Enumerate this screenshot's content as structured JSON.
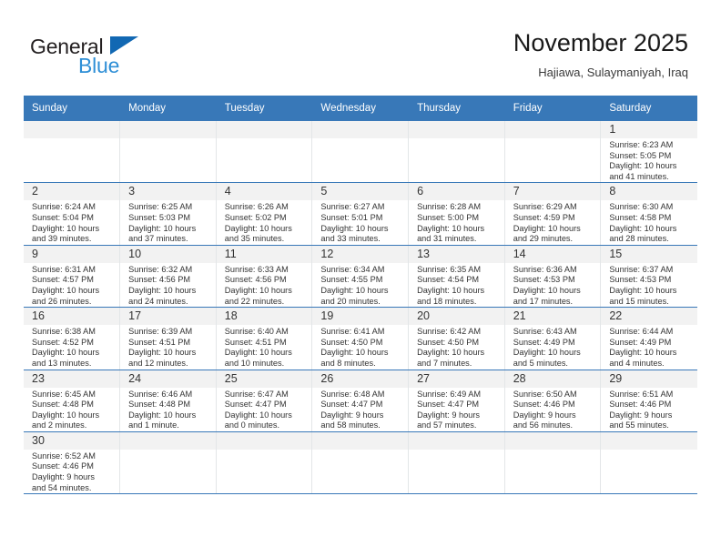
{
  "logo": {
    "text_primary": "General",
    "text_secondary": "Blue",
    "icon": "triangle-mark",
    "color_primary": "#231f20",
    "color_secondary": "#2f8fd6",
    "color_triangle": "#1268b3"
  },
  "header": {
    "title": "November 2025",
    "subtitle": "Hajiawa, Sulaymaniyah, Iraq"
  },
  "theme": {
    "header_blue": "#3878b8",
    "daynum_band": "#f2f2f2",
    "text": "#333333"
  },
  "weekdays": [
    "Sunday",
    "Monday",
    "Tuesday",
    "Wednesday",
    "Thursday",
    "Friday",
    "Saturday"
  ],
  "weeks": [
    [
      {
        "empty": true
      },
      {
        "empty": true
      },
      {
        "empty": true
      },
      {
        "empty": true
      },
      {
        "empty": true
      },
      {
        "empty": true
      },
      {
        "day": "1",
        "sunrise": "Sunrise: 6:23 AM",
        "sunset": "Sunset: 5:05 PM",
        "daylight1": "Daylight: 10 hours",
        "daylight2": "and 41 minutes."
      }
    ],
    [
      {
        "day": "2",
        "sunrise": "Sunrise: 6:24 AM",
        "sunset": "Sunset: 5:04 PM",
        "daylight1": "Daylight: 10 hours",
        "daylight2": "and 39 minutes."
      },
      {
        "day": "3",
        "sunrise": "Sunrise: 6:25 AM",
        "sunset": "Sunset: 5:03 PM",
        "daylight1": "Daylight: 10 hours",
        "daylight2": "and 37 minutes."
      },
      {
        "day": "4",
        "sunrise": "Sunrise: 6:26 AM",
        "sunset": "Sunset: 5:02 PM",
        "daylight1": "Daylight: 10 hours",
        "daylight2": "and 35 minutes."
      },
      {
        "day": "5",
        "sunrise": "Sunrise: 6:27 AM",
        "sunset": "Sunset: 5:01 PM",
        "daylight1": "Daylight: 10 hours",
        "daylight2": "and 33 minutes."
      },
      {
        "day": "6",
        "sunrise": "Sunrise: 6:28 AM",
        "sunset": "Sunset: 5:00 PM",
        "daylight1": "Daylight: 10 hours",
        "daylight2": "and 31 minutes."
      },
      {
        "day": "7",
        "sunrise": "Sunrise: 6:29 AM",
        "sunset": "Sunset: 4:59 PM",
        "daylight1": "Daylight: 10 hours",
        "daylight2": "and 29 minutes."
      },
      {
        "day": "8",
        "sunrise": "Sunrise: 6:30 AM",
        "sunset": "Sunset: 4:58 PM",
        "daylight1": "Daylight: 10 hours",
        "daylight2": "and 28 minutes."
      }
    ],
    [
      {
        "day": "9",
        "sunrise": "Sunrise: 6:31 AM",
        "sunset": "Sunset: 4:57 PM",
        "daylight1": "Daylight: 10 hours",
        "daylight2": "and 26 minutes."
      },
      {
        "day": "10",
        "sunrise": "Sunrise: 6:32 AM",
        "sunset": "Sunset: 4:56 PM",
        "daylight1": "Daylight: 10 hours",
        "daylight2": "and 24 minutes."
      },
      {
        "day": "11",
        "sunrise": "Sunrise: 6:33 AM",
        "sunset": "Sunset: 4:56 PM",
        "daylight1": "Daylight: 10 hours",
        "daylight2": "and 22 minutes."
      },
      {
        "day": "12",
        "sunrise": "Sunrise: 6:34 AM",
        "sunset": "Sunset: 4:55 PM",
        "daylight1": "Daylight: 10 hours",
        "daylight2": "and 20 minutes."
      },
      {
        "day": "13",
        "sunrise": "Sunrise: 6:35 AM",
        "sunset": "Sunset: 4:54 PM",
        "daylight1": "Daylight: 10 hours",
        "daylight2": "and 18 minutes."
      },
      {
        "day": "14",
        "sunrise": "Sunrise: 6:36 AM",
        "sunset": "Sunset: 4:53 PM",
        "daylight1": "Daylight: 10 hours",
        "daylight2": "and 17 minutes."
      },
      {
        "day": "15",
        "sunrise": "Sunrise: 6:37 AM",
        "sunset": "Sunset: 4:53 PM",
        "daylight1": "Daylight: 10 hours",
        "daylight2": "and 15 minutes."
      }
    ],
    [
      {
        "day": "16",
        "sunrise": "Sunrise: 6:38 AM",
        "sunset": "Sunset: 4:52 PM",
        "daylight1": "Daylight: 10 hours",
        "daylight2": "and 13 minutes."
      },
      {
        "day": "17",
        "sunrise": "Sunrise: 6:39 AM",
        "sunset": "Sunset: 4:51 PM",
        "daylight1": "Daylight: 10 hours",
        "daylight2": "and 12 minutes."
      },
      {
        "day": "18",
        "sunrise": "Sunrise: 6:40 AM",
        "sunset": "Sunset: 4:51 PM",
        "daylight1": "Daylight: 10 hours",
        "daylight2": "and 10 minutes."
      },
      {
        "day": "19",
        "sunrise": "Sunrise: 6:41 AM",
        "sunset": "Sunset: 4:50 PM",
        "daylight1": "Daylight: 10 hours",
        "daylight2": "and 8 minutes."
      },
      {
        "day": "20",
        "sunrise": "Sunrise: 6:42 AM",
        "sunset": "Sunset: 4:50 PM",
        "daylight1": "Daylight: 10 hours",
        "daylight2": "and 7 minutes."
      },
      {
        "day": "21",
        "sunrise": "Sunrise: 6:43 AM",
        "sunset": "Sunset: 4:49 PM",
        "daylight1": "Daylight: 10 hours",
        "daylight2": "and 5 minutes."
      },
      {
        "day": "22",
        "sunrise": "Sunrise: 6:44 AM",
        "sunset": "Sunset: 4:49 PM",
        "daylight1": "Daylight: 10 hours",
        "daylight2": "and 4 minutes."
      }
    ],
    [
      {
        "day": "23",
        "sunrise": "Sunrise: 6:45 AM",
        "sunset": "Sunset: 4:48 PM",
        "daylight1": "Daylight: 10 hours",
        "daylight2": "and 2 minutes."
      },
      {
        "day": "24",
        "sunrise": "Sunrise: 6:46 AM",
        "sunset": "Sunset: 4:48 PM",
        "daylight1": "Daylight: 10 hours",
        "daylight2": "and 1 minute."
      },
      {
        "day": "25",
        "sunrise": "Sunrise: 6:47 AM",
        "sunset": "Sunset: 4:47 PM",
        "daylight1": "Daylight: 10 hours",
        "daylight2": "and 0 minutes."
      },
      {
        "day": "26",
        "sunrise": "Sunrise: 6:48 AM",
        "sunset": "Sunset: 4:47 PM",
        "daylight1": "Daylight: 9 hours",
        "daylight2": "and 58 minutes."
      },
      {
        "day": "27",
        "sunrise": "Sunrise: 6:49 AM",
        "sunset": "Sunset: 4:47 PM",
        "daylight1": "Daylight: 9 hours",
        "daylight2": "and 57 minutes."
      },
      {
        "day": "28",
        "sunrise": "Sunrise: 6:50 AM",
        "sunset": "Sunset: 4:46 PM",
        "daylight1": "Daylight: 9 hours",
        "daylight2": "and 56 minutes."
      },
      {
        "day": "29",
        "sunrise": "Sunrise: 6:51 AM",
        "sunset": "Sunset: 4:46 PM",
        "daylight1": "Daylight: 9 hours",
        "daylight2": "and 55 minutes."
      }
    ],
    [
      {
        "day": "30",
        "sunrise": "Sunrise: 6:52 AM",
        "sunset": "Sunset: 4:46 PM",
        "daylight1": "Daylight: 9 hours",
        "daylight2": "and 54 minutes."
      },
      {
        "empty": true
      },
      {
        "empty": true
      },
      {
        "empty": true
      },
      {
        "empty": true
      },
      {
        "empty": true
      },
      {
        "empty": true
      }
    ]
  ]
}
